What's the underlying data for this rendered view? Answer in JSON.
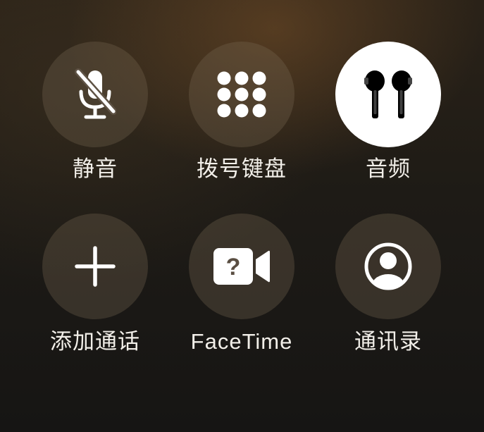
{
  "controls": [
    {
      "id": "mute",
      "label": "静音",
      "icon": "mic-slash-icon",
      "active": false
    },
    {
      "id": "keypad",
      "label": "拨号键盘",
      "icon": "keypad-icon",
      "active": false
    },
    {
      "id": "audio",
      "label": "音频",
      "icon": "airpods-icon",
      "active": true
    },
    {
      "id": "add-call",
      "label": "添加通话",
      "icon": "plus-icon",
      "active": false
    },
    {
      "id": "facetime",
      "label": "FaceTime",
      "icon": "video-question-icon",
      "active": false
    },
    {
      "id": "contacts",
      "label": "通讯录",
      "icon": "person-circle-icon",
      "active": false
    }
  ],
  "colors": {
    "button_bg": "#6b5d4c",
    "button_active_bg": "#ffffff",
    "icon": "#ffffff",
    "icon_active": "#000000",
    "label": "#f2efe9"
  }
}
